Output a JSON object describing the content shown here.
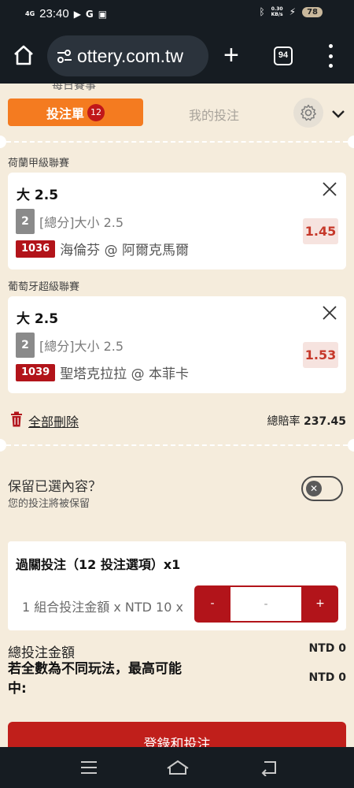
{
  "status_bar": {
    "time": "23:40",
    "signal": "4G",
    "net_speed_value": "0.30",
    "net_speed_unit": "KB/s",
    "battery": "78"
  },
  "browser": {
    "url": "ottery.com.tw",
    "tab_count": "94"
  },
  "page": {
    "peek_text": "每日賽事",
    "tabs": {
      "betslip_label": "投注單",
      "betslip_count": "12",
      "mybets_label": "我的投注"
    },
    "bets": [
      {
        "league": "荷蘭甲級聯賽",
        "selection": "大 2.5",
        "market_num": "2",
        "market": "[總分]大小 2.5",
        "match_code": "1036",
        "match": "海倫芬 @ 阿爾克馬爾",
        "odds": "1.45"
      },
      {
        "league": "葡萄牙超級聯賽",
        "selection": "大 2.5",
        "market_num": "2",
        "market": "[總分]大小 2.5",
        "match_code": "1039",
        "match": "聖塔克拉拉 @ 本菲卡",
        "odds": "1.53"
      }
    ],
    "delete_all": "全部刪除",
    "total_odds_label": "總賠率",
    "total_odds": "237.45",
    "keep": {
      "title": "保留已選內容？",
      "subtitle": "您的投注將被保留",
      "enabled": false
    },
    "parlay": {
      "title": "過關投注（12 投注選項）x1",
      "unit_label": "1 組合投注金額 x NTD 10 x",
      "minus": "-",
      "amount": "-",
      "plus": "+"
    },
    "total_stake_label": "總投注金額",
    "total_stake_value": "NTD 0",
    "max_win_label": "若全數為不同玩法，最高可能中:",
    "max_win_value": "NTD 0",
    "submit_label": "登錄和投注"
  }
}
